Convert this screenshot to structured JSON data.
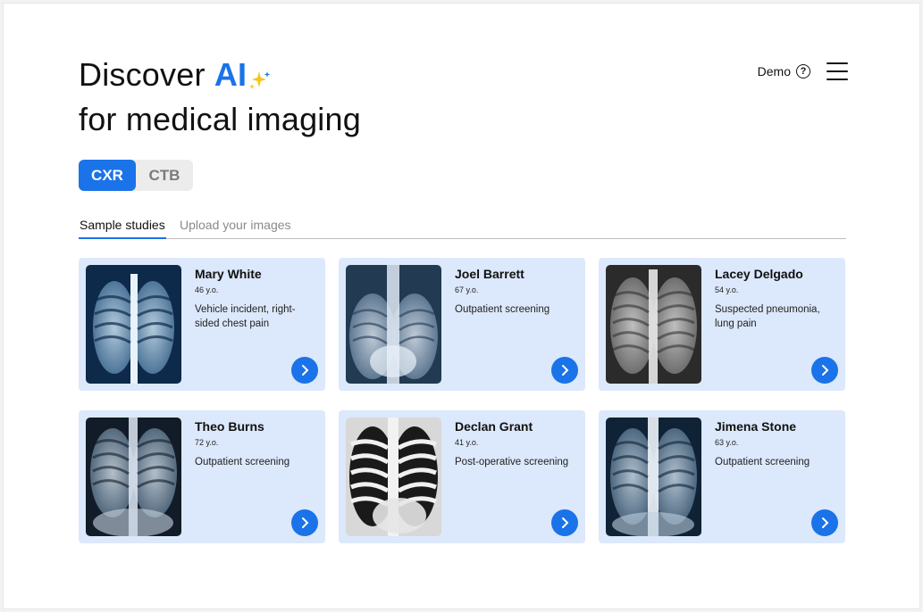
{
  "hero": {
    "line1_prefix": "Discover",
    "line1_highlight": "AI",
    "line2": "for medical imaging"
  },
  "header": {
    "demo_label": "Demo",
    "help_icon": "question-circle-icon",
    "menu_icon": "hamburger-menu-icon"
  },
  "modality_toggle": {
    "options": [
      "CXR",
      "CTB"
    ],
    "selected": "CXR"
  },
  "tabs": {
    "items": [
      "Sample studies",
      "Upload your images"
    ],
    "active": "Sample studies"
  },
  "studies": [
    {
      "name": "Mary White",
      "age": "46 y.o.",
      "description": "Vehicle incident, right-sided chest pain"
    },
    {
      "name": "Joel Barrett",
      "age": "67 y.o.",
      "description": "Outpatient screening"
    },
    {
      "name": "Lacey Delgado",
      "age": "54 y.o.",
      "description": "Suspected pneumonia, lung pain"
    },
    {
      "name": "Theo Burns",
      "age": "72 y.o.",
      "description": "Outpatient screening"
    },
    {
      "name": "Declan Grant",
      "age": "41 y.o.",
      "description": "Post-operative screening"
    },
    {
      "name": "Jimena Stone",
      "age": "63 y.o.",
      "description": "Outpatient screening"
    }
  ],
  "colors": {
    "accent": "#1a73e8",
    "card_bg": "#dce8fb",
    "toggle_bg": "#ececec"
  }
}
